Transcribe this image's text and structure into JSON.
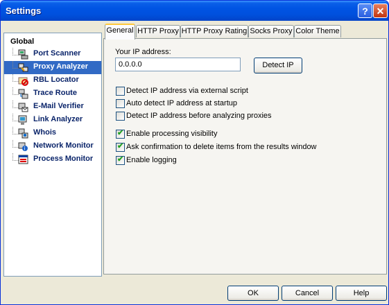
{
  "window": {
    "title": "Settings"
  },
  "titlebar": {
    "help_label": "?",
    "close_label": "✕"
  },
  "sidebar": {
    "group_label": "Global",
    "items": [
      {
        "label": "Port Scanner",
        "icon": "port-scanner-icon"
      },
      {
        "label": "Proxy Analyzer",
        "icon": "proxy-analyzer-icon",
        "selected": true
      },
      {
        "label": "RBL Locator",
        "icon": "rbl-locator-icon"
      },
      {
        "label": "Trace Route",
        "icon": "trace-route-icon"
      },
      {
        "label": "E-Mail Verifier",
        "icon": "email-verifier-icon"
      },
      {
        "label": "Link Analyzer",
        "icon": "link-analyzer-icon"
      },
      {
        "label": "Whois",
        "icon": "whois-icon"
      },
      {
        "label": "Network Monitor",
        "icon": "network-monitor-icon"
      },
      {
        "label": "Process Monitor",
        "icon": "process-monitor-icon"
      }
    ]
  },
  "tabs": [
    {
      "label": "General",
      "active": true
    },
    {
      "label": "HTTP Proxy"
    },
    {
      "label": "HTTP Proxy Rating"
    },
    {
      "label": "Socks Proxy"
    },
    {
      "label": "Color Theme"
    }
  ],
  "general": {
    "ip_label": "Your IP address:",
    "ip_value": "0.0.0.0",
    "detect_button": "Detect IP",
    "checkboxes": [
      {
        "label": "Detect IP address via external script",
        "checked": false
      },
      {
        "label": "Auto detect IP address at startup",
        "checked": false
      },
      {
        "label": "Detect IP address before analyzing proxies",
        "checked": false
      },
      {
        "label": "Enable processing visibility",
        "checked": true
      },
      {
        "label": "Ask confirmation to delete items from the results window",
        "checked": true
      },
      {
        "label": "Enable logging",
        "checked": true
      }
    ]
  },
  "buttons": {
    "ok": "OK",
    "cancel": "Cancel",
    "help": "Help"
  }
}
